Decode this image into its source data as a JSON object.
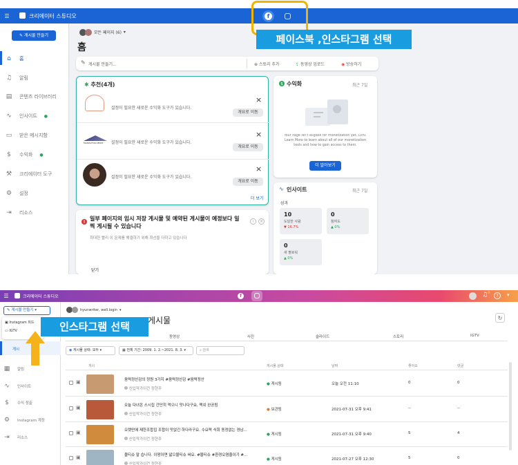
{
  "panel1": {
    "topbar": {
      "app_name": "크리에이터 스튜디오"
    },
    "create_post": "게시물 만들기",
    "page_selector": "모든 페이지 (6)",
    "page_title": "홈",
    "nav": [
      "홈",
      "알림",
      "콘텐츠 라이브러리",
      "인사이트",
      "받은 메시지함",
      "수익화",
      "크리에이터 도구",
      "설정",
      "리소스"
    ],
    "composer": {
      "placeholder": "게시물 만들기...",
      "story": "스토리 추가",
      "upload": "동영상 업로드",
      "live": "방송하기"
    },
    "recommend": {
      "title": "추천(4개)",
      "items": [
        {
          "text": "설정이 필요한 새로운 수익화 도구가 있습니다.",
          "btn": "개요로 이동"
        },
        {
          "text": "설정이 필요한 새로운 수익화 도구가 있습니다.",
          "btn": "개요로 이동",
          "logo": "MANHATTAN PRINT"
        },
        {
          "text": "설정이 필요한 새로운 수익화 도구가 있습니다.",
          "btn": "개요로 이동"
        }
      ],
      "more": "더 보기"
    },
    "alert": {
      "title": "일부 페이지의 임시 저장 게시물 및 예약된 게시물이 예정보다 일찍 게시될 수 있습니다",
      "desc": "최대한 빨리 이 문제를 해결하기 위해 최선을 다하고 있습니다",
      "close": "닫기"
    },
    "monetize": {
      "title": "수익화",
      "period": "최근 7일",
      "desc": "Your Page isn't eligible for monetization yet. Clini. Learn More to learn about all of our monetization tools and how to gain access to them.",
      "btn": "더 알아보기"
    },
    "insights": {
      "title": "인사이트",
      "period": "최근 7일",
      "section": "성과",
      "stats": [
        {
          "value": "10",
          "label": "도달한 사람",
          "delta": "▼ 16.7%",
          "up": false
        },
        {
          "value": "0",
          "label": "참여도",
          "delta": "▲ 0%",
          "up": true
        },
        {
          "value": "0",
          "label": "새 팔로워",
          "delta": "▲ 0%",
          "up": true
        }
      ]
    },
    "callout": "페이스북 ,인스타그램 선택"
  },
  "panel2": {
    "topbar": {
      "app_name": "크리에이터 스튜디오"
    },
    "create_post": "게시물 만들기",
    "dropdown": [
      "Instagram 피드",
      "IGTV"
    ],
    "account": "hyunwriter, well.login",
    "page_title": "게시물",
    "callout": "인스타그램 선택",
    "tabs": [
      "동영상",
      "사진",
      "슬라이드",
      "스토리",
      "IGTV"
    ],
    "filters": {
      "status": "게시물 상태: 모두",
      "period": "전체 기간: 2009. 1. 2.~2021. 8. 3.",
      "search_placeholder": "검색"
    },
    "nav": [
      "알림",
      "인사이트",
      "수익 창출",
      "Instagram 계정",
      "리소스"
    ],
    "nav_partial": "게시",
    "columns": [
      "게시",
      "게시물 상태",
      "날짜",
      "좋아요",
      "댓글"
    ],
    "rows": [
      {
        "text": "음력정산감의 정원 3가지 #음력정산감 #음력정산",
        "author": "신입작가이건 정현주",
        "status": "게시됨",
        "date": "오늘 오전 11:10",
        "likes": "0",
        "comments": "0",
        "thumb": "#c89a72"
      },
      {
        "text": "오늘 다녀온 스시집 간단히 먹으니 맛나다구요, 맥쉬 완공됨",
        "author": "신입작가이건 정현주",
        "status": "보관됨",
        "date": "2021-07-31 오후 9:41",
        "likes": "--",
        "comments": "--",
        "thumb": "#b85a3a"
      },
      {
        "text": "오랫만에 제한조합집 조합이 맛없긴 하다라구요. 수요력 식회 동정없는 경남...",
        "author": "신입작가이건 정현주",
        "status": "게시됨",
        "date": "2021-07-31 오후 9:40",
        "likes": "5",
        "comments": "4",
        "thumb": "#d08b3c"
      },
      {
        "text": "물티슈 말 습니다. 이왕이면 얇으물티슈 써요. #물티슈 #환경오염줄이기 #...",
        "author": "신입작가이건 정현주",
        "status": "게시됨",
        "date": "2021-07-27 오후 12:30",
        "likes": "5",
        "comments": "0",
        "thumb": "#9fb5c4"
      }
    ]
  },
  "colors": {
    "fb_blue": "#1b64d6",
    "callout_bg": "#1a9ce0",
    "highlight": "#f0b400",
    "arrow": "#f6b21b",
    "posted": "#2aa55b",
    "draft": "#e47a2e"
  }
}
